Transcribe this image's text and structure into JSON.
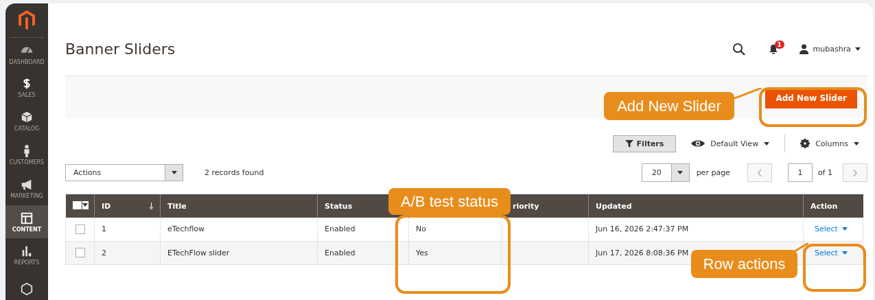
{
  "sidebar": {
    "items": [
      {
        "label": "DASHBOARD",
        "selected": false
      },
      {
        "label": "SALES",
        "selected": false
      },
      {
        "label": "CATALOG",
        "selected": false
      },
      {
        "label": "CUSTOMERS",
        "selected": false
      },
      {
        "label": "MARKETING",
        "selected": false
      },
      {
        "label": "CONTENT",
        "selected": true
      },
      {
        "label": "REPORTS",
        "selected": false
      },
      {
        "selected": false
      }
    ]
  },
  "header": {
    "title": "Banner Sliders",
    "notifications": "1",
    "user": "mubashra"
  },
  "page_actions": {
    "button": "Add New Slider"
  },
  "toolbar": {
    "filters": "Filters",
    "view": "Default View",
    "columns": "Columns"
  },
  "mass_actions": {
    "value": "Actions"
  },
  "records": "2 records found",
  "pagination": {
    "per_page": "20",
    "per_page_label": "per page",
    "page": "1",
    "of": "of 1"
  },
  "table": {
    "columns": [
      {
        "kind": "select",
        "checked": false
      },
      {
        "kind": "text",
        "label": "ID",
        "sorted": true
      },
      {
        "kind": "text",
        "label": "Title",
        "sorted": false
      },
      {
        "kind": "text",
        "label": "Status"
      },
      {
        "kind": "text"
      },
      {
        "kind": "text",
        "label": "riority",
        "sorted": false
      },
      {
        "kind": "text",
        "label": "Updated",
        "sorted": false
      },
      {
        "kind": "text",
        "label": "Action",
        "sorted": false
      }
    ],
    "rows": [
      {
        "checked": false,
        "id": "1",
        "title": "eTechflow",
        "status": "Enabled",
        "column_5": "No",
        "updated": "Jun 16, 2026 2:47:37 PM",
        "action": "Select"
      },
      {
        "checked": false,
        "id": "2",
        "title": "ETechFlow slider",
        "status": "Enabled",
        "column_5": "Yes",
        "updated": "Jun 17, 2026 8:08:36 PM",
        "action": "Select"
      }
    ]
  },
  "annotations": [
    {
      "text": "Add New Slider"
    },
    {
      "text": "A/B test status"
    },
    {
      "text": "Row actions"
    }
  ]
}
